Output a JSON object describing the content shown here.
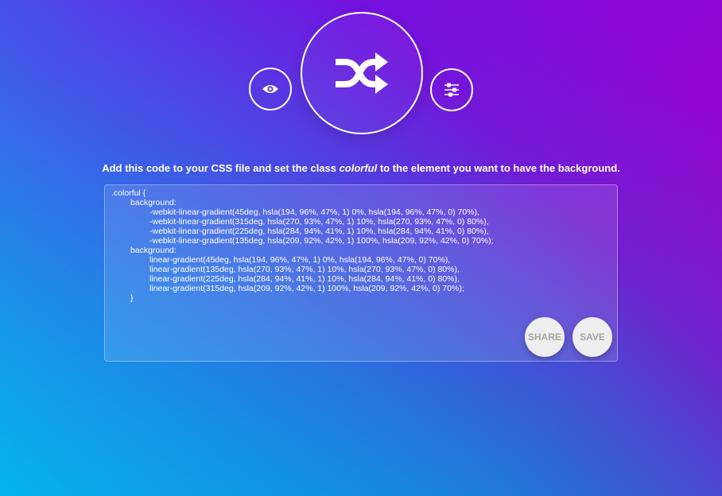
{
  "controls": {
    "preview_icon": "eye-icon",
    "shuffle_icon": "shuffle-icon",
    "settings_icon": "sliders-icon"
  },
  "instructions": {
    "before": "Add this code to your CSS file and set the class ",
    "class_name": "colorful",
    "after": " to the element you want to have the background."
  },
  "code": {
    "lines": [
      {
        "indent": 0,
        "text": ".colorful {"
      },
      {
        "indent": 1,
        "text": "background:"
      },
      {
        "indent": 2,
        "text": "-webkit-linear-gradient(45deg, hsla(194, 96%, 47%, 1) 0%, hsla(194, 96%, 47%, 0) 70%),"
      },
      {
        "indent": 2,
        "text": "-webkit-linear-gradient(315deg, hsla(270, 93%, 47%, 1) 10%, hsla(270, 93%, 47%, 0) 80%),"
      },
      {
        "indent": 2,
        "text": "-webkit-linear-gradient(225deg, hsla(284, 94%, 41%, 1) 10%, hsla(284, 94%, 41%, 0) 80%),"
      },
      {
        "indent": 2,
        "text": "-webkit-linear-gradient(135deg, hsla(209, 92%, 42%, 1) 100%, hsla(209, 92%, 42%, 0) 70%);"
      },
      {
        "indent": 1,
        "text": "background:"
      },
      {
        "indent": 2,
        "text": "linear-gradient(45deg, hsla(194, 96%, 47%, 1) 0%, hsla(194, 96%, 47%, 0) 70%),"
      },
      {
        "indent": 2,
        "text": "linear-gradient(135deg, hsla(270, 93%, 47%, 1) 10%, hsla(270, 93%, 47%, 0) 80%),"
      },
      {
        "indent": 2,
        "text": "linear-gradient(225deg, hsla(284, 94%, 41%, 1) 10%, hsla(284, 94%, 41%, 0) 80%),"
      },
      {
        "indent": 2,
        "text": "linear-gradient(315deg, hsla(209, 92%, 42%, 1) 100%, hsla(209, 92%, 42%, 0) 70%);"
      },
      {
        "indent": 1,
        "text": "}"
      }
    ]
  },
  "actions": {
    "share_label": "SHARE",
    "save_label": "SAVE"
  },
  "colors": {
    "foreground": "#ffffff",
    "button_bg": "#eeeeee",
    "button_text": "#a5a5a5"
  }
}
